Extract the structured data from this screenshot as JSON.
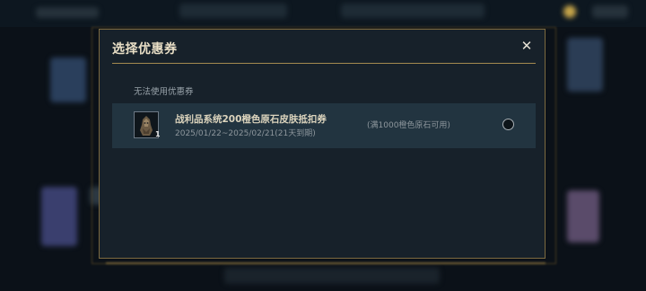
{
  "dialog": {
    "title": "选择优惠券",
    "close_label": "✕",
    "section_label": "无法使用优惠券"
  },
  "coupons": [
    {
      "name": "战利品系统200橙色原石皮肤抵扣券",
      "validity": "2025/01/22~2025/02/21(21天到期)",
      "condition": "(满1000橙色原石可用)",
      "quantity": "1",
      "selected": false
    }
  ],
  "colors": {
    "gold_border": "#7d6a40",
    "dialog_bg": "#17212a",
    "row_bg": "#223440"
  }
}
